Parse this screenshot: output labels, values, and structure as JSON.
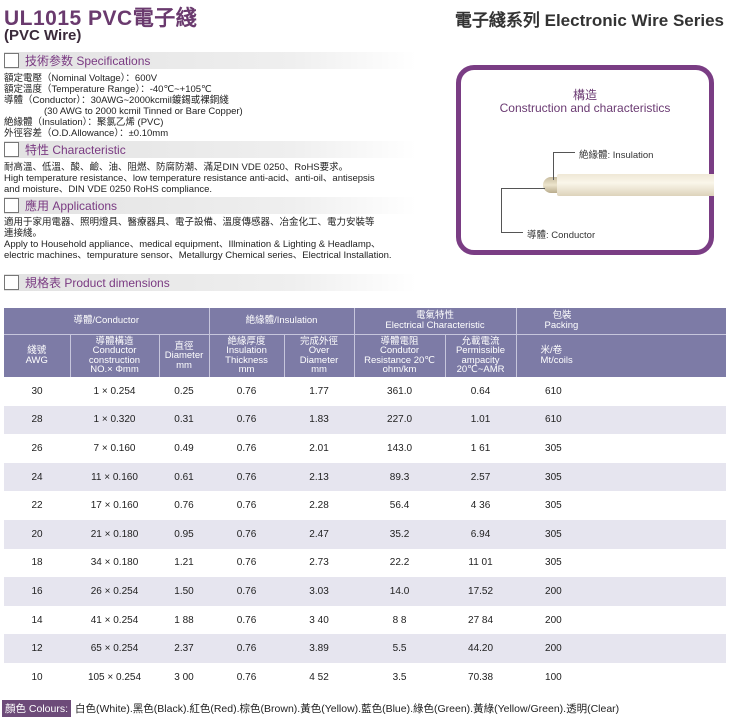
{
  "header": {
    "title": "UL1015 PVC電子綫",
    "subtitle": "(PVC Wire)",
    "series": "電子綫系列 Electronic Wire Series"
  },
  "sections": {
    "specifications": "技術参数 Specifications",
    "characteristic": "特性 Characteristic",
    "applications": "應用 Applications",
    "dimensions": "規格表 Product dimensions"
  },
  "specs": [
    "額定電壓（Nominal Voltage）：600V",
    "額定溫度（Temperature Range）：-40℃~+105℃",
    "導體（Conductor）：30AWG~2000kcmil鍍錫或裸銅綫",
    "(30 AWG to 2000 kcmil Tinned or Bare Copper)",
    "絶緣體（Insulation）：聚氯乙烯 (PVC)",
    "外徑容差（O.D.Allowance）：±0.10mm"
  ],
  "characteristic": [
    "耐高溫、低溫、酸、鹼、油、阻燃、防腐防潮、滿足DIN VDE 0250、RoHS要求。",
    "High temperature resistance、low temperature resistance anti-acid、anti-oil、antisepsis",
    "and moisture、DIN VDE 0250 RoHS compliance."
  ],
  "applications": [
    "適用于家用電器、照明燈具、醫療器具、電子設備、溫度傳感器、冶金化工、電力安裝等",
    "連接綫。",
    "Apply to Household appliance、medical equipment、Illmination & Lighting & Headlamp、",
    "electric machines、tempurature sensor、Metallurgy Chemical series、Electrical Installation."
  ],
  "construction": {
    "title_cn": "構造",
    "title_en": "Construction and characteristics",
    "insulation_label": "絶緣體: Insulation",
    "conductor_label": "導體: Conductor"
  },
  "table": {
    "group_headers": {
      "conductor": "導體/Conductor",
      "insulation": "絶緣體/Insulation",
      "electrical_cn": "電氣特性",
      "electrical_en": "Electrical Characteristic",
      "packing_cn": "包裝",
      "packing_en": "Packing"
    },
    "columns": {
      "awg": [
        "綫號",
        "AWG"
      ],
      "construction": [
        "導體構造",
        "Conductor",
        "construction",
        "NO.× Φmm"
      ],
      "diameter": [
        "直徑",
        "Diameter",
        "mm"
      ],
      "thickness": [
        "絶緣厚度",
        "Insulation",
        "Thickness",
        "mm"
      ],
      "overall": [
        "完成外徑",
        "Over",
        "Diameter",
        "mm"
      ],
      "resistance": [
        "導體電阻",
        "Condutor",
        "Resistance 20℃",
        "ohm/km"
      ],
      "ampacity": [
        "允載電流",
        "Permissible",
        "ampacity",
        "20℃~AMR"
      ],
      "packing": [
        "米/卷",
        "Mt/coils"
      ]
    },
    "rows": [
      [
        "30",
        "1 × 0.254",
        "0.25",
        "0.76",
        "1.77",
        "361.0",
        "0.64",
        "610"
      ],
      [
        "28",
        "1 × 0.320",
        "0.31",
        "0.76",
        "1.83",
        "227.0",
        "1.01",
        "610"
      ],
      [
        "26",
        "7 × 0.160",
        "0.49",
        "0.76",
        "2.01",
        "143.0",
        "1 61",
        "305"
      ],
      [
        "24",
        "11 × 0.160",
        "0.61",
        "0.76",
        "2.13",
        "89.3",
        "2.57",
        "305"
      ],
      [
        "22",
        "17 × 0.160",
        "0.76",
        "0.76",
        "2.28",
        "56.4",
        "4 36",
        "305"
      ],
      [
        "20",
        "21 × 0.180",
        "0.95",
        "0.76",
        "2.47",
        "35.2",
        "6.94",
        "305"
      ],
      [
        "18",
        "34 × 0.180",
        "1.21",
        "0.76",
        "2.73",
        "22.2",
        "11 01",
        "305"
      ],
      [
        "16",
        "26 × 0.254",
        "1.50",
        "0.76",
        "3.03",
        "14.0",
        "17.52",
        "200"
      ],
      [
        "14",
        "41 × 0.254",
        "1 88",
        "0.76",
        "3 40",
        "8 8",
        "27 84",
        "200"
      ],
      [
        "12",
        "65 × 0.254",
        "2.37",
        "0.76",
        "3.89",
        "5.5",
        "44.20",
        "200"
      ],
      [
        "10",
        "105 × 0.254",
        "3 00",
        "0.76",
        "4 52",
        "3.5",
        "70.38",
        "100"
      ]
    ]
  },
  "colours": {
    "label": "顏色 Colours:",
    "list": "白色(White).黑色(Black).紅色(Red).棕色(Brown).黃色(Yellow).藍色(Blue).綠色(Green).黃綠(Yellow/Green).透明(Clear)"
  }
}
